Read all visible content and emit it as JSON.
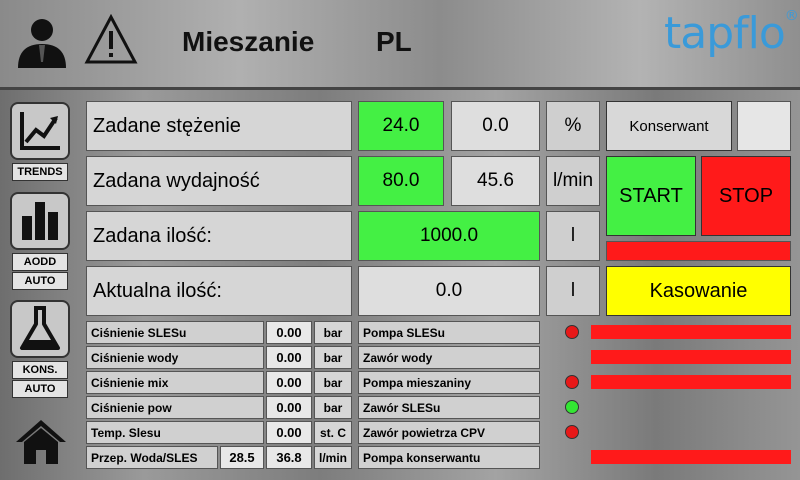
{
  "header": {
    "title": "Mieszanie",
    "language": "PL",
    "logo_text": "tapflo",
    "logo_mark": "®"
  },
  "nav": {
    "trends_label": "TRENDS",
    "aodd_label": "AODD",
    "aodd_mode": "AUTO",
    "kons_label": "KONS.",
    "kons_mode": "AUTO",
    "icons": [
      "user-icon",
      "warning-icon",
      "trend-chart-icon",
      "bar-chart-icon",
      "flask-icon",
      "home-icon"
    ]
  },
  "params": {
    "conc": {
      "label": "Zadane stężenie",
      "set": "24.0",
      "actual": "0.0",
      "unit": "%"
    },
    "flow": {
      "label": "Zadana wydajność",
      "set": "80.0",
      "actual": "45.6",
      "unit": "l/min"
    },
    "qty": {
      "label": "Zadana ilość:",
      "set": "1000.0",
      "unit": "l"
    },
    "aqty": {
      "label": "Aktualna ilość:",
      "value": "0.0",
      "unit": "l"
    }
  },
  "controls": {
    "preservative_label": "Konserwant",
    "start_label": "START",
    "stop_label": "STOP",
    "reset_label": "Kasowanie"
  },
  "sensors": [
    {
      "label": "Ciśnienie SLESu",
      "value": "0.00",
      "unit": "bar"
    },
    {
      "label": "Ciśnienie wody",
      "value": "0.00",
      "unit": "bar"
    },
    {
      "label": "Ciśnienie mix",
      "value": "0.00",
      "unit": "bar"
    },
    {
      "label": "Ciśnienie pow",
      "value": "0.00",
      "unit": "bar"
    },
    {
      "label": "Temp. Slesu",
      "value": "0.00",
      "unit": "st. C"
    }
  ],
  "ratio": {
    "label": "Przep. Woda/SLES",
    "value1": "28.5",
    "value2": "36.8",
    "unit": "l/min"
  },
  "devices": [
    {
      "label": "Pompa SLESu",
      "indicator": "#e81818",
      "bar": true
    },
    {
      "label": "Zawór wody",
      "indicator": "",
      "bar": true
    },
    {
      "label": "Pompa mieszaniny",
      "indicator": "#e81818",
      "bar": true
    },
    {
      "label": "Zawór SLESu",
      "indicator": "#33e633",
      "bar": false
    },
    {
      "label": "Zawór powietrza CPV",
      "indicator": "#e81818",
      "bar": false
    },
    {
      "label": "Pompa konserwantu",
      "indicator": "",
      "bar": true
    }
  ],
  "colors": {
    "green": "#44f044",
    "red": "#ff1a1a",
    "yellow": "#ffff00",
    "accent": "#3a9ad9"
  }
}
